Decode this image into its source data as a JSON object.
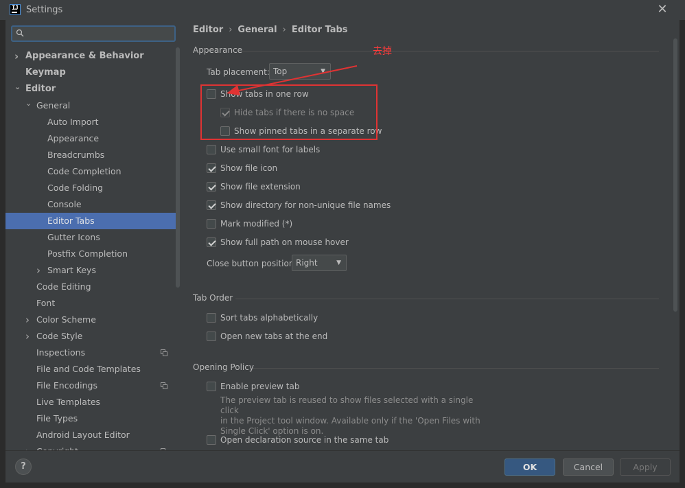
{
  "window": {
    "title": "Settings",
    "app_icon": "IJ",
    "close_icon": "✕"
  },
  "sidebar": {
    "search": {
      "value": "",
      "placeholder": ""
    },
    "items": [
      {
        "label": "Appearance & Behavior",
        "expand": "collapsed"
      },
      {
        "label": "Keymap",
        "expand": "none"
      },
      {
        "label": "Editor",
        "expand": "expanded"
      },
      {
        "label": "General",
        "expand": "expanded"
      },
      {
        "label": "Auto Import"
      },
      {
        "label": "Appearance"
      },
      {
        "label": "Breadcrumbs"
      },
      {
        "label": "Code Completion"
      },
      {
        "label": "Code Folding"
      },
      {
        "label": "Console"
      },
      {
        "label": "Editor Tabs",
        "selected": true
      },
      {
        "label": "Gutter Icons"
      },
      {
        "label": "Postfix Completion"
      },
      {
        "label": "Smart Keys",
        "expand": "collapsed"
      },
      {
        "label": "Code Editing"
      },
      {
        "label": "Font"
      },
      {
        "label": "Color Scheme",
        "expand": "collapsed"
      },
      {
        "label": "Code Style",
        "expand": "collapsed"
      },
      {
        "label": "Inspections",
        "has_copy_icon": true
      },
      {
        "label": "File and Code Templates"
      },
      {
        "label": "File Encodings",
        "has_copy_icon": true
      },
      {
        "label": "Live Templates"
      },
      {
        "label": "File Types"
      },
      {
        "label": "Android Layout Editor"
      },
      {
        "label": "Copyright",
        "expand": "collapsed",
        "has_copy_icon": true
      }
    ]
  },
  "breadcrumb": {
    "parts": [
      "Editor",
      "General",
      "Editor Tabs"
    ],
    "separator": "›"
  },
  "appearance": {
    "title": "Appearance",
    "tab_placement_label": "Tab placement:",
    "tab_placement_value": "Top",
    "options": [
      {
        "label": "Show tabs in one row",
        "checked": false,
        "enabled": true
      },
      {
        "label": "Hide tabs if there is no space",
        "checked": true,
        "enabled": false
      },
      {
        "label": "Show pinned tabs in a separate row",
        "checked": false,
        "enabled": true
      },
      {
        "label": "Use small font for labels",
        "checked": false,
        "enabled": true
      },
      {
        "label": "Show file icon",
        "checked": true,
        "enabled": true
      },
      {
        "label": "Show file extension",
        "checked": true,
        "enabled": true
      },
      {
        "label": "Show directory for non-unique file names",
        "checked": true,
        "enabled": true
      },
      {
        "label": "Mark modified (*)",
        "checked": false,
        "enabled": true
      },
      {
        "label": "Show full path on mouse hover",
        "checked": true,
        "enabled": true
      }
    ],
    "close_button_label": "Close button position:",
    "close_button_value": "Right"
  },
  "tab_order": {
    "title": "Tab Order",
    "options": [
      {
        "label": "Sort tabs alphabetically",
        "checked": false
      },
      {
        "label": "Open new tabs at the end",
        "checked": false
      }
    ]
  },
  "opening_policy": {
    "title": "Opening Policy",
    "preview": {
      "label": "Enable preview tab",
      "checked": false
    },
    "preview_desc": [
      "The preview tab is reused to show files selected with a single click",
      "in the Project tool window. Available only if the 'Open Files with",
      "Single Click' option is on."
    ],
    "declaration": {
      "label": "Open declaration source in the same tab",
      "checked": false
    }
  },
  "annotation": {
    "text": "去掉",
    "color": "#e03333"
  },
  "footer": {
    "help": "?",
    "ok": "OK",
    "cancel": "Cancel",
    "apply": "Apply"
  },
  "colors": {
    "selection": "#4b6eaf",
    "primary_button": "#365880",
    "panel": "#3c3f41"
  }
}
